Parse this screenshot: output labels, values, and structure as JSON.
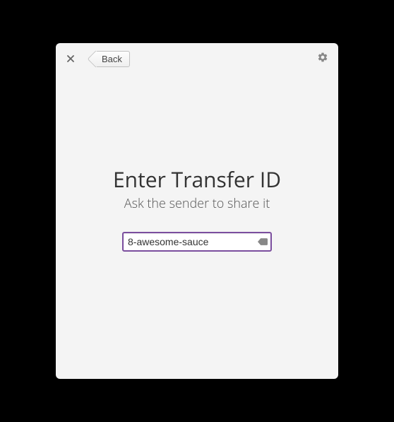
{
  "header": {
    "back_label": "Back"
  },
  "main": {
    "title": "Enter Transfer ID",
    "subtitle": "Ask the sender to share it",
    "input_value": "8-awesome-sauce"
  }
}
